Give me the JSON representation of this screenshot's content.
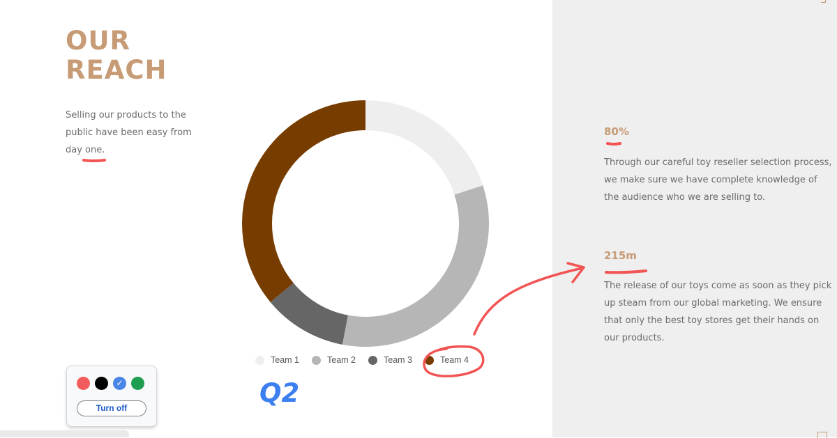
{
  "slide": {
    "title_line1": "OUR",
    "title_line2": "REACH",
    "intro": "Selling our products to the public have been easy from day one."
  },
  "stats": [
    {
      "value": "80%",
      "text": "Through our careful toy reseller selection process, we make sure we have complete knowledge of the audience who we are selling to."
    },
    {
      "value": "215m",
      "text": "The release of our toys come as soon as they pick up steam from our global marketing. We ensure that only the best toy stores get their hands on our products."
    }
  ],
  "chart_data": {
    "type": "pie",
    "variant": "donut",
    "categories": [
      "Team 1",
      "Team 2",
      "Team 3",
      "Team 4"
    ],
    "values": [
      20,
      33,
      11,
      36
    ],
    "colors": [
      "#eeeeee",
      "#b6b6b6",
      "#666666",
      "#773c00"
    ],
    "legend_position": "bottom"
  },
  "annotation": {
    "handwritten_text": "Q2",
    "ink_colors": {
      "red": "#f25454",
      "blue": "#3b7ff0"
    }
  },
  "pen_tool": {
    "colors": [
      "#f25c5c",
      "#000000",
      "#4a86e8",
      "#1e9e50"
    ],
    "selected_index": 2,
    "turn_off_label": "Turn off"
  }
}
